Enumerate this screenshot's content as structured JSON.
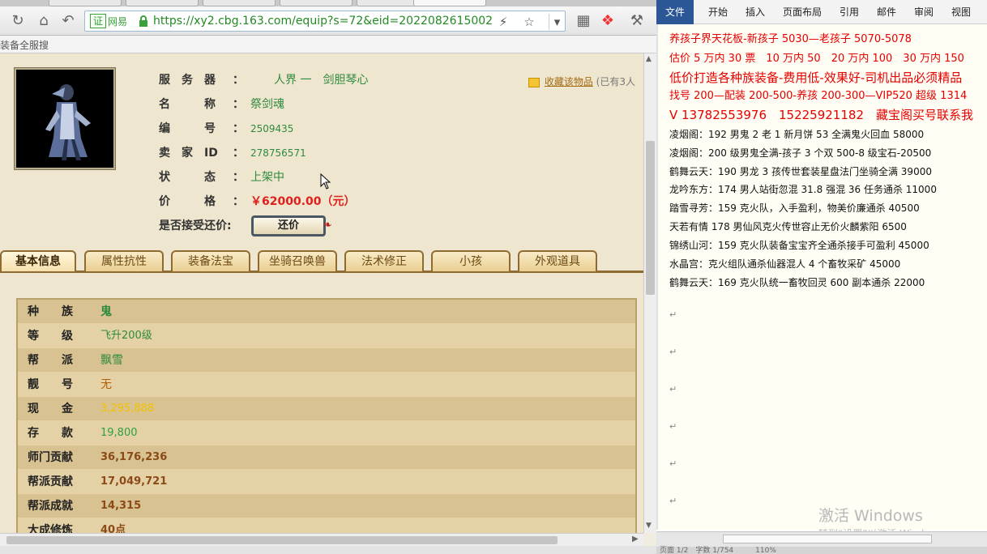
{
  "browser": {
    "url": "https://xy2.cbg.163.com/equip?s=72&eid=202208261500213-",
    "badge_label": "证",
    "badge_site": "网易",
    "bookmark_text": "装备全服搜",
    "icons": [
      "refresh-icon",
      "home-icon",
      "back-icon",
      "lightning-icon",
      "star-icon",
      "dropdown-icon",
      "apps-icon",
      "game-icon",
      "tools-icon"
    ]
  },
  "item": {
    "labels": {
      "server": "服　务　器",
      "name": "名　　　称",
      "number": "编　　　号",
      "seller": "卖　家　ID",
      "status": "状　　　态",
      "price": "价　　　格",
      "counter": "是否接受还价:"
    },
    "colon": "：",
    "server": "人界 一　剑胆琴心",
    "name": "祭剑魂",
    "number": "2509435",
    "seller_id": "278756571",
    "status": "上架中",
    "price": "￥62000.00（元）",
    "counter_button": "还价",
    "favorite": "收藏该物品",
    "favorite_extra": "(已有3人"
  },
  "tabs": [
    "基本信息",
    "属性抗性",
    "装备法宝",
    "坐骑召唤兽",
    "法术修正",
    "小孩",
    "外观道具"
  ],
  "attributes": [
    {
      "key": "种　　族",
      "value": "鬼",
      "color": "#2f8a3f"
    },
    {
      "key": "等　　级",
      "value": "飞升200级",
      "color": "#2f8a3f"
    },
    {
      "key": "帮　　派",
      "value": "飘雪",
      "color": "#2f8a3f"
    },
    {
      "key": "靓　　号",
      "value": "无",
      "color": "#b45f06"
    },
    {
      "key": "现　　金",
      "value": "3,295,888",
      "color": "#f2c200"
    },
    {
      "key": "存　　款",
      "value": "19,800",
      "color": "#2fa040"
    },
    {
      "key": "师门贡献",
      "value": "36,176,236",
      "color": "#8b4a16"
    },
    {
      "key": "帮派贡献",
      "value": "17,049,721",
      "color": "#8b4a16"
    },
    {
      "key": "帮派成就",
      "value": "14,315",
      "color": "#8b4a16"
    },
    {
      "key": "大成修炼",
      "value": "40点",
      "color": "#8b4a16"
    }
  ],
  "word": {
    "ribbon_tabs": [
      "文件",
      "开始",
      "插入",
      "页面布局",
      "引用",
      "邮件",
      "审阅",
      "视图"
    ],
    "lines": [
      {
        "text": "养孩子界天花板-新孩子 5030—老孩子 5070-5078",
        "style": "red"
      },
      {
        "text": "估价 5 万内 30 票　10 万内 50　20 万内 100　30 万内 150",
        "style": "red"
      },
      {
        "text": "低价打造各种族装备-费用低-效果好-司机出品必须精品",
        "style": "red big"
      },
      {
        "text": "找号 200—配装 200-500-养孩 200-300—VIP520 超级 1314",
        "style": "red"
      },
      {
        "text": "V 13782553976　15225921182　藏宝阁买号联系我",
        "style": "red big"
      },
      {
        "text": "凌烟阁：192 男鬼 2 老 1 新月饼 53 全满鬼火回血 58000",
        "style": "black"
      },
      {
        "text": "凌烟阁：200 级男鬼全满-孩子 3 个双 500-8 级宝石-20500",
        "style": "black"
      },
      {
        "text": "鹤舞云天：190 男龙 3 孩传世套装星盘法门坐骑全满 39000",
        "style": "black"
      },
      {
        "text": "龙吟东方：174 男人站街忽混 31.8 强混 36 任务通杀 11000",
        "style": "black"
      },
      {
        "text": "踏雪寻芳：159 克火队，入手盈利，物美价廉通杀 40500",
        "style": "black"
      },
      {
        "text": "天若有情 178 男仙风克火传世容止无价火麟紫阳 6500",
        "style": "black"
      },
      {
        "text": "锦绣山河：159 克火队装备宝宝齐全通杀接手可盈利 45000",
        "style": "black"
      },
      {
        "text": "水晶宫：克火组队通杀仙器混人 4 个畜牧采矿 45000",
        "style": "black"
      },
      {
        "text": "鹤舞云天：169 克火队统一畜牧回灵 600 副本通杀 22000",
        "style": "black"
      }
    ],
    "para_mark": "↵",
    "watermark_title": "激活 Windows",
    "watermark_sub": "转到“设置”以激活 Windows。",
    "status_text": "页面 1/2　字数 1/754　　　110%"
  }
}
